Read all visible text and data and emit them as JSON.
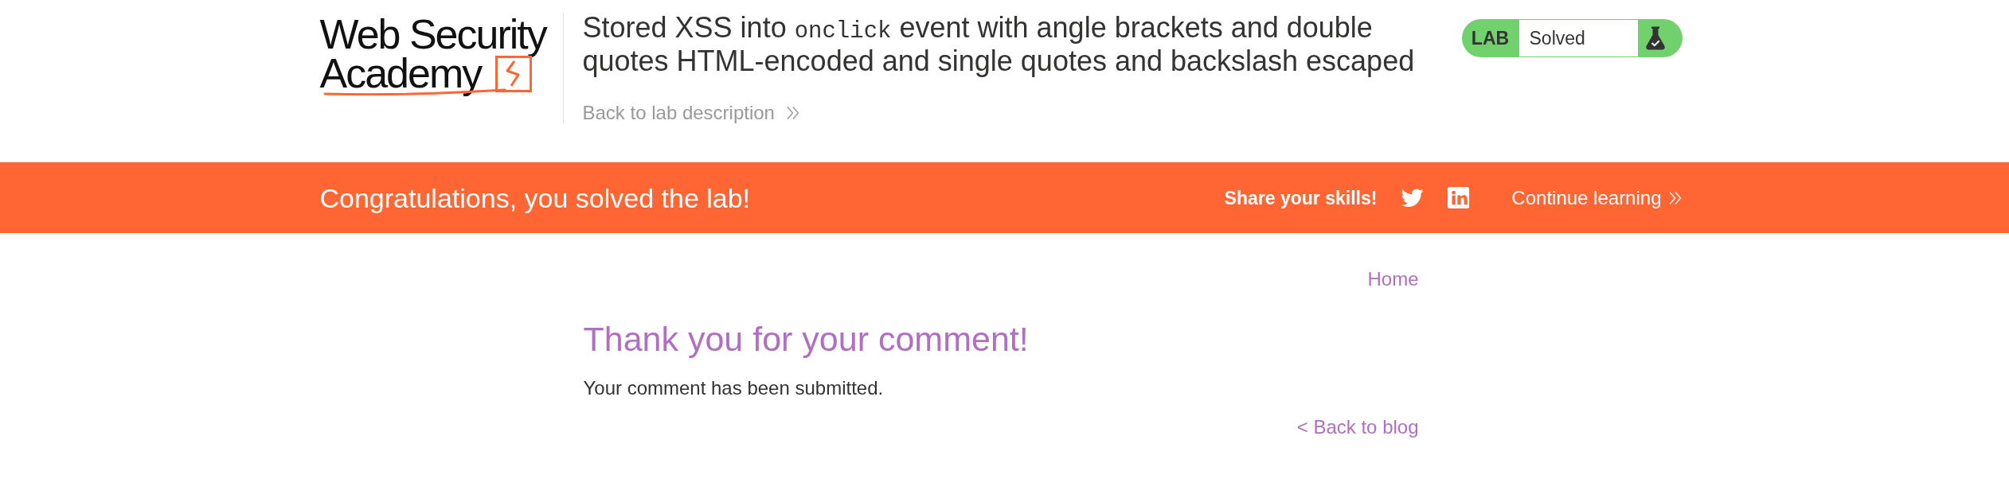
{
  "header": {
    "logo": {
      "line_1": "Web Security",
      "line_2": "Academy"
    },
    "title": [
      {
        "kind": "text",
        "text": "Stored XSS into "
      },
      {
        "kind": "code",
        "text": "onclick"
      },
      {
        "kind": "text",
        "text": " event with angle brackets and double quotes HTML-encoded and single quotes and backslash escaped"
      }
    ],
    "back_link": "Back to lab description",
    "lab_status": {
      "label": "LAB",
      "status": "Solved",
      "solved": true
    }
  },
  "banner": {
    "message": "Congratulations, you solved the lab!",
    "share_label": "Share your skills!",
    "continue_link": "Continue learning"
  },
  "content": {
    "nav_link": "Home",
    "heading": "Thank you for your comment!",
    "message": "Your comment has been submitted.",
    "back_link": "< Back to blog"
  }
}
